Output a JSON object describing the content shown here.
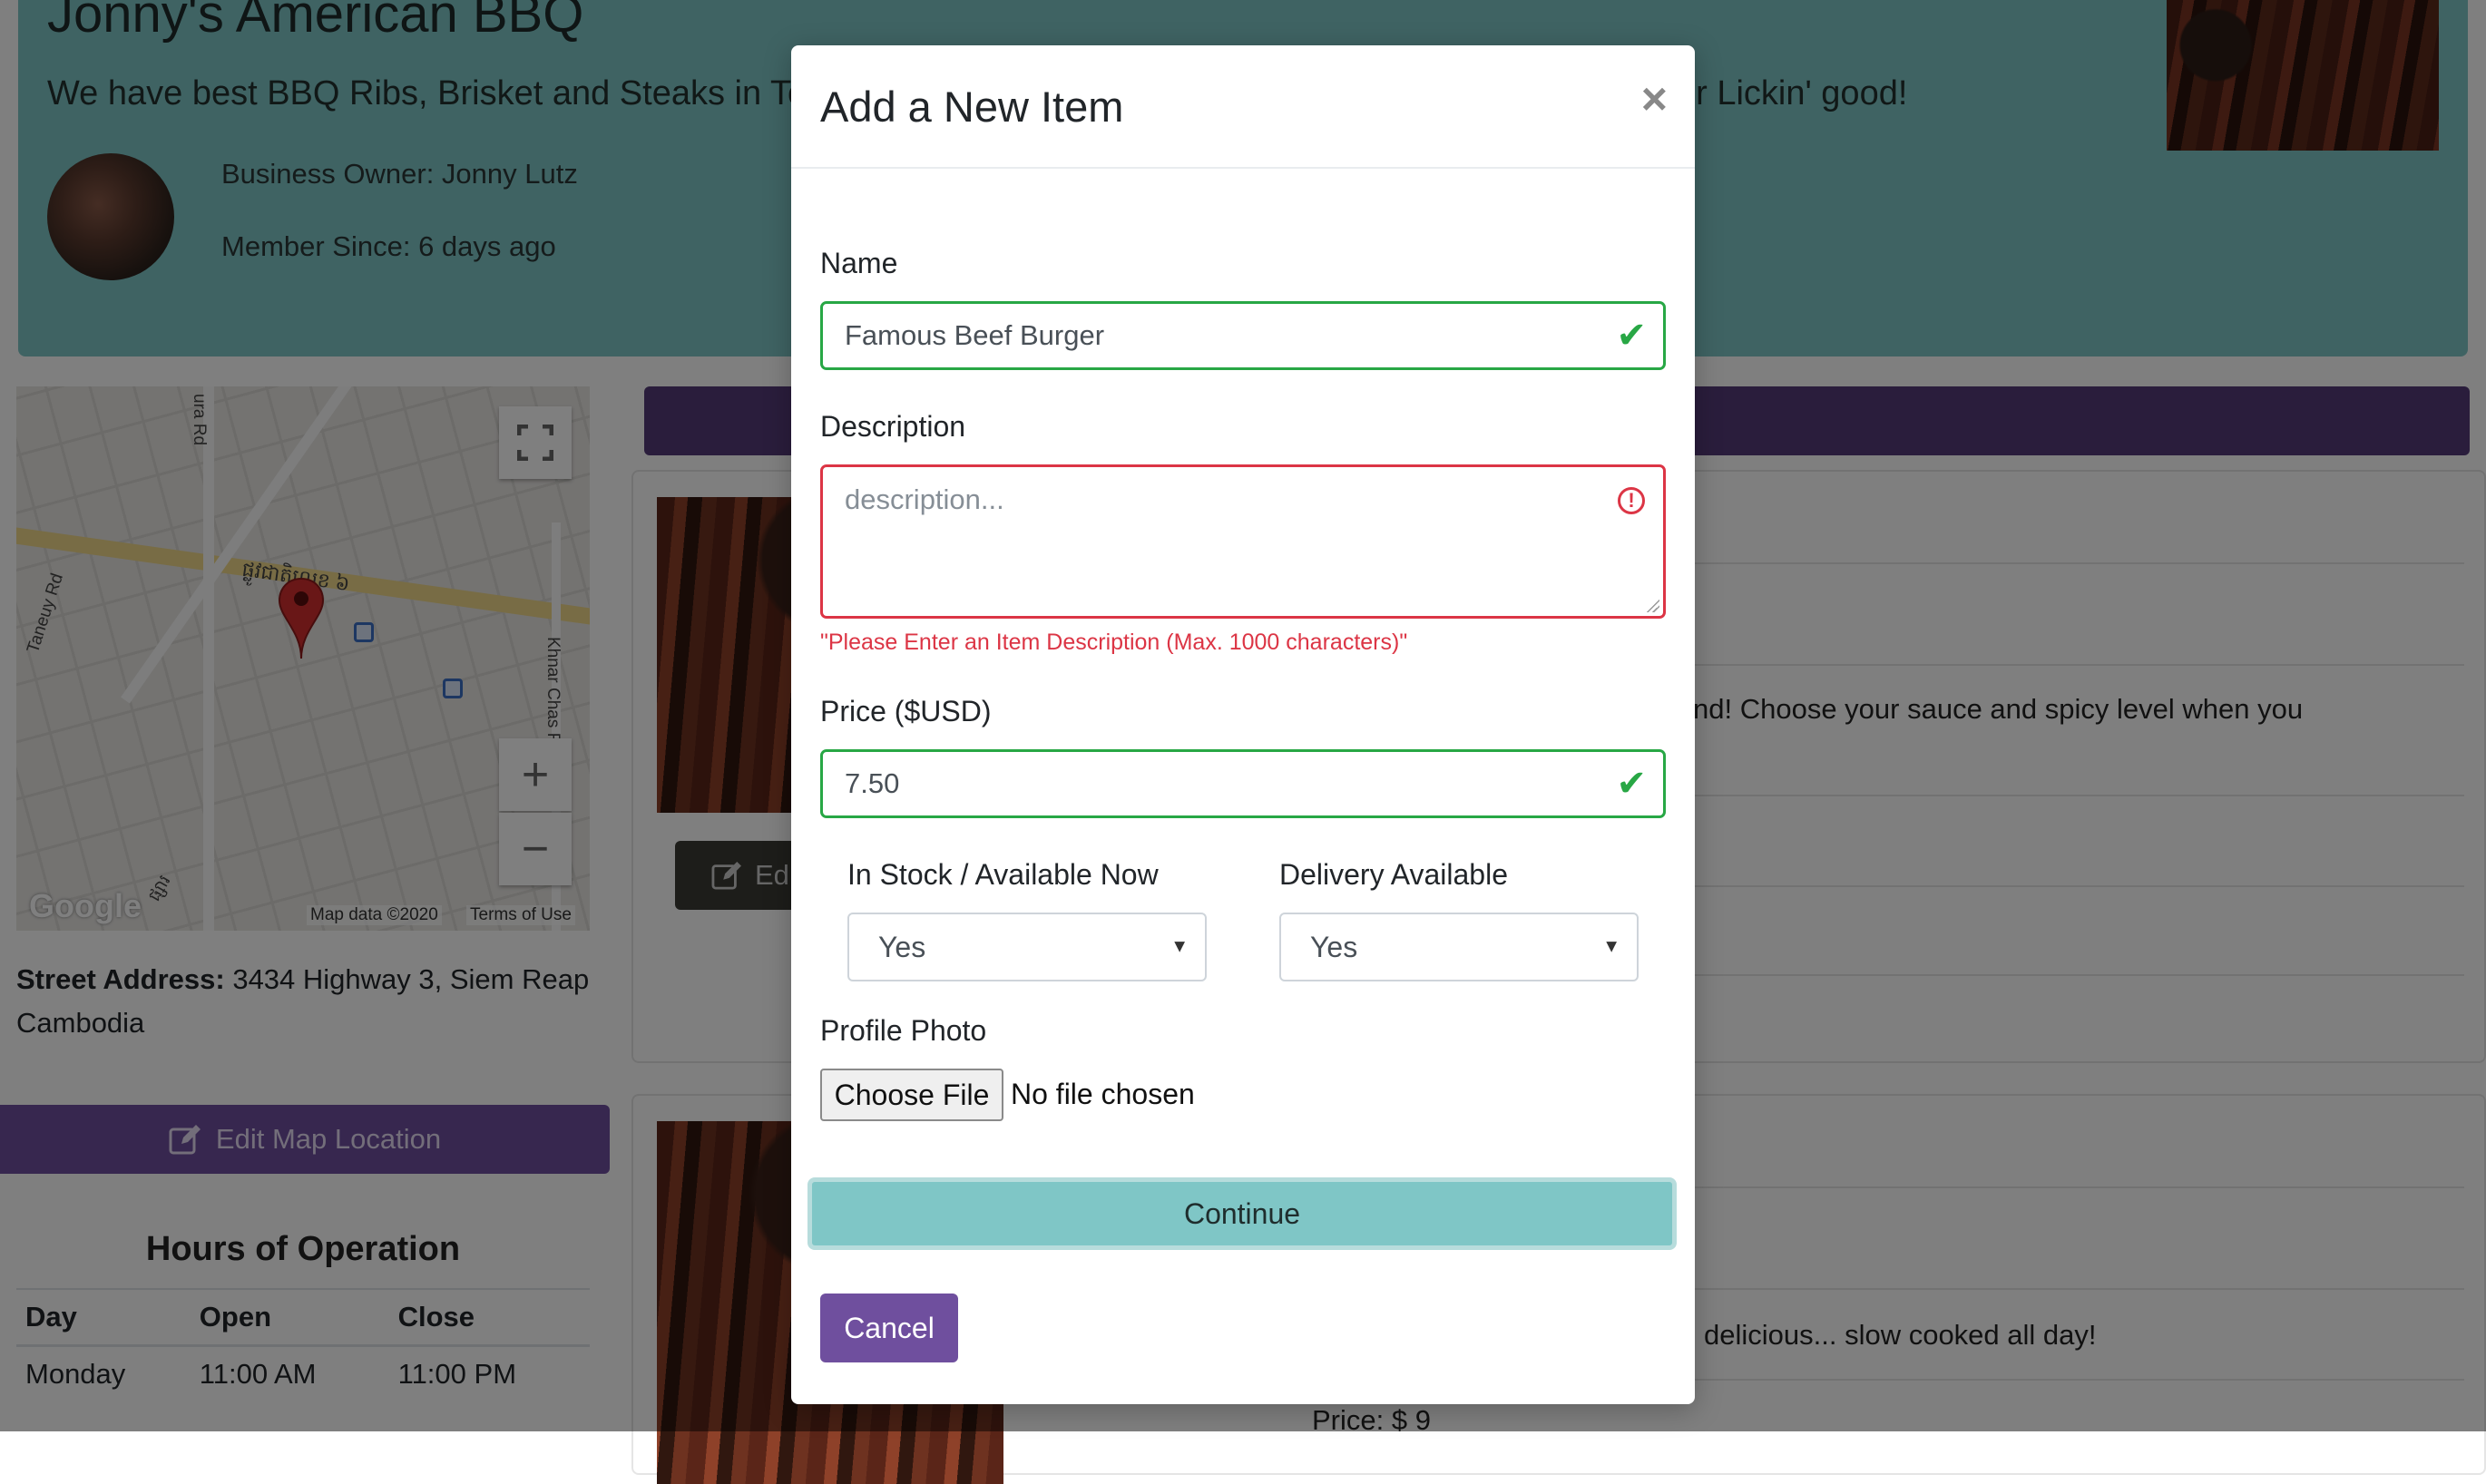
{
  "business": {
    "name": "Jonny's American BBQ",
    "tagline": "We have best BBQ Ribs, Brisket and Steaks in To",
    "tagline_tail": "r Lickin' good!",
    "owner": "Business Owner: Jonny Lutz",
    "member_since": "Member Since: 6 days ago"
  },
  "map": {
    "labels": [
      "ura Rd",
      "Taneuy Rd",
      "ផ្លូវជាតិលេខ ៦",
      "Khnar Chas F",
      "ផ្សារ"
    ],
    "google": "Google",
    "map_data": "Map data ©2020",
    "terms": "Terms of Use",
    "zoom_in": "+",
    "zoom_out": "−"
  },
  "address": {
    "label": "Street Address:",
    "value": "3434 Highway 3, Siem Reap Cambodia"
  },
  "edit_map_label": "Edit Map Location",
  "hours": {
    "title": "Hours of Operation",
    "headers": [
      "Day",
      "Open",
      "Close"
    ],
    "rows": [
      [
        "Monday",
        "11:00 AM",
        "11:00 PM"
      ]
    ]
  },
  "menu_peek": {
    "edit_label": "Ed",
    "line1": "nd! Choose your sauce and spicy level when you",
    "line2": "delicious... slow cooked all day!",
    "price": "Price: $ 9"
  },
  "modal": {
    "title": "Add a New Item",
    "close": "×",
    "name_label": "Name",
    "name_value": "Famous Beef Burger",
    "description_label": "Description",
    "description_placeholder": "description...",
    "description_error": "\"Please Enter an Item Description (Max. 1000 characters)\"",
    "price_label": "Price ($USD)",
    "price_value": "7.50",
    "stock_label": "In Stock / Available Now",
    "stock_value": "Yes",
    "delivery_label": "Delivery Available",
    "delivery_value": "Yes",
    "photo_label": "Profile Photo",
    "choose_file": "Choose File",
    "file_status": "No file chosen",
    "continue": "Continue",
    "cancel": "Cancel"
  },
  "colors": {
    "teal": "#7fc6c6",
    "purple": "#6f4f9e",
    "valid": "#28a745",
    "invalid": "#dc3545"
  }
}
